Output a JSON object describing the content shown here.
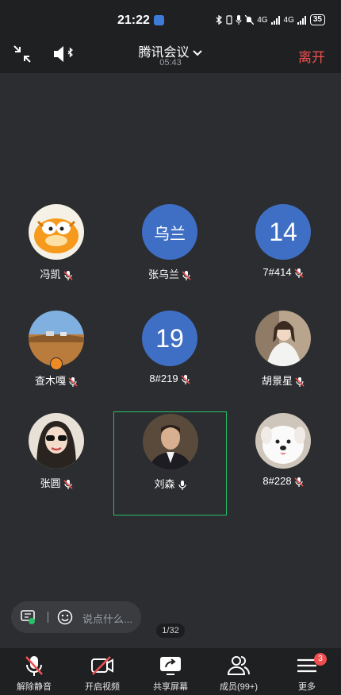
{
  "status_bar": {
    "time": "21:22",
    "network_1": "4G",
    "network_2": "4G",
    "battery": "35"
  },
  "header": {
    "title": "腾讯会议",
    "timer": "05:43",
    "leave_label": "离开"
  },
  "participants": [
    {
      "name": "冯凯",
      "avatar_type": "photo",
      "photo": "garfield",
      "mic": "muted"
    },
    {
      "name": "张乌兰",
      "avatar_type": "text",
      "avatar_text": "乌兰",
      "mic": "muted"
    },
    {
      "name": "7#414",
      "avatar_type": "text",
      "avatar_text": "14",
      "mic": "muted"
    },
    {
      "name": "查木嘎",
      "avatar_type": "photo",
      "photo": "landscape",
      "mic": "muted",
      "host": true
    },
    {
      "name": "8#219",
      "avatar_type": "text",
      "avatar_text": "19",
      "mic": "muted"
    },
    {
      "name": "胡景星",
      "avatar_type": "photo",
      "photo": "woman-white",
      "mic": "muted"
    },
    {
      "name": "张圆",
      "avatar_type": "photo",
      "photo": "woman-sunglasses",
      "mic": "muted"
    },
    {
      "name": "刘森",
      "avatar_type": "photo",
      "photo": "man-suit",
      "mic": "on",
      "active": true
    },
    {
      "name": "8#228",
      "avatar_type": "photo",
      "photo": "white-dog",
      "mic": "muted"
    }
  ],
  "chat": {
    "placeholder": "说点什么..."
  },
  "page_indicator": "1/32",
  "toolbar": {
    "unmute": "解除静音",
    "video": "开启视频",
    "share": "共享屏幕",
    "members": "成员(99+)",
    "more": "更多",
    "more_badge": "3"
  },
  "colors": {
    "accent_red": "#f04f4f",
    "active_green": "#27c067",
    "text_avatar": "#3f6fc4"
  }
}
